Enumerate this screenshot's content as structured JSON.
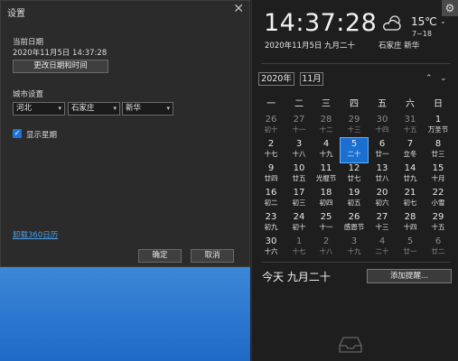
{
  "settings": {
    "title": "设置",
    "close_icon": "close-icon",
    "current_date_label": "当前日期",
    "current_date_value": "2020年11月5日 14:37:28",
    "change_date_button": "更改日期和时间",
    "city_label": "城市设置",
    "province": "河北",
    "city": "石家庄",
    "district": "新华",
    "show_week_label": "显示星期",
    "show_week_checked": true,
    "link_text": "卸载360日历",
    "ok_button": "确定",
    "cancel_button": "取消"
  },
  "panel": {
    "time": "14:37:28",
    "date_line": "2020年11月5日 九月二十",
    "weather_icon": "partly-cloudy-icon",
    "temperature": "15℃",
    "temp_range": "7~18",
    "location": "石家庄 新华",
    "settings_icon": "gear-icon",
    "year": "2020年",
    "month": "11月",
    "weekdays": [
      "一",
      "二",
      "三",
      "四",
      "五",
      "六",
      "日"
    ],
    "weeks": [
      [
        {
          "d": "26",
          "l": "初十",
          "dim": true
        },
        {
          "d": "27",
          "l": "十一",
          "dim": true
        },
        {
          "d": "28",
          "l": "十二",
          "dim": true
        },
        {
          "d": "29",
          "l": "十三",
          "dim": true
        },
        {
          "d": "30",
          "l": "十四",
          "dim": true
        },
        {
          "d": "31",
          "l": "十五",
          "dim": true
        },
        {
          "d": "1",
          "l": "万圣节"
        }
      ],
      [
        {
          "d": "2",
          "l": "十七"
        },
        {
          "d": "3",
          "l": "十八"
        },
        {
          "d": "4",
          "l": "十九"
        },
        {
          "d": "5",
          "l": "二十",
          "today": true
        },
        {
          "d": "6",
          "l": "廿一"
        },
        {
          "d": "7",
          "l": "立冬"
        },
        {
          "d": "8",
          "l": "廿三"
        }
      ],
      [
        {
          "d": "9",
          "l": "廿四"
        },
        {
          "d": "10",
          "l": "廿五"
        },
        {
          "d": "11",
          "l": "光棍节"
        },
        {
          "d": "12",
          "l": "廿七"
        },
        {
          "d": "13",
          "l": "廿八"
        },
        {
          "d": "14",
          "l": "廿九"
        },
        {
          "d": "15",
          "l": "十月"
        }
      ],
      [
        {
          "d": "16",
          "l": "初二"
        },
        {
          "d": "17",
          "l": "初三"
        },
        {
          "d": "18",
          "l": "初四"
        },
        {
          "d": "19",
          "l": "初五"
        },
        {
          "d": "20",
          "l": "初六"
        },
        {
          "d": "21",
          "l": "初七"
        },
        {
          "d": "22",
          "l": "小雪"
        }
      ],
      [
        {
          "d": "23",
          "l": "初九"
        },
        {
          "d": "24",
          "l": "初十"
        },
        {
          "d": "25",
          "l": "十一"
        },
        {
          "d": "26",
          "l": "感恩节"
        },
        {
          "d": "27",
          "l": "十三"
        },
        {
          "d": "28",
          "l": "十四"
        },
        {
          "d": "29",
          "l": "十五"
        }
      ],
      [
        {
          "d": "30",
          "l": "十六"
        },
        {
          "d": "1",
          "l": "十七",
          "dim": true
        },
        {
          "d": "2",
          "l": "十八",
          "dim": true
        },
        {
          "d": "3",
          "l": "十九",
          "dim": true
        },
        {
          "d": "4",
          "l": "二十",
          "dim": true
        },
        {
          "d": "5",
          "l": "廿一",
          "dim": true
        },
        {
          "d": "6",
          "l": "廿二",
          "dim": true
        }
      ]
    ],
    "today_label": "今天 九月二十",
    "add_reminder_button": "添加提醒...",
    "tray_icon": "inbox-icon"
  }
}
